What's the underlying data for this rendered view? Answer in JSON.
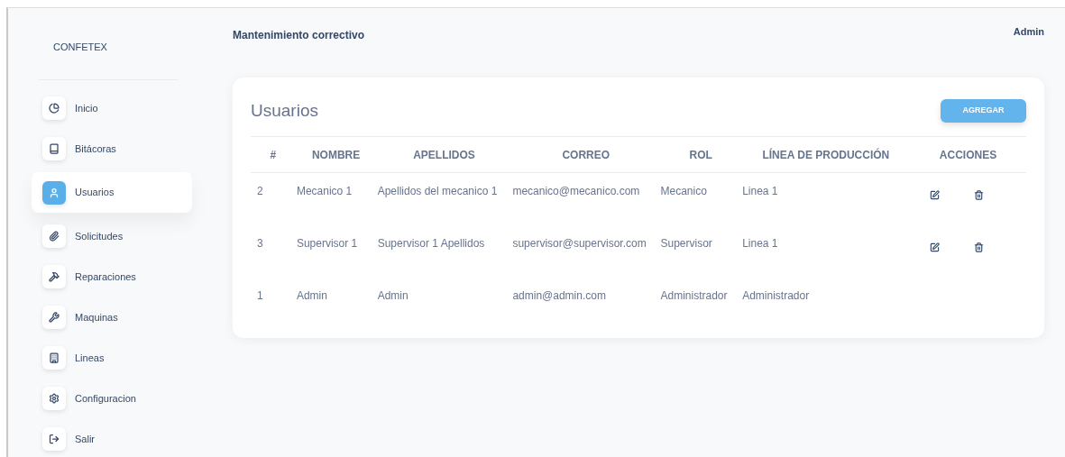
{
  "sidebar": {
    "brand": "CONFETEX",
    "items": [
      {
        "label": "Inicio",
        "selected": false
      },
      {
        "label": "Bitácoras",
        "selected": false
      },
      {
        "label": "Usuarios",
        "selected": true
      },
      {
        "label": "Solicitudes",
        "selected": false
      },
      {
        "label": "Reparaciones",
        "selected": false
      },
      {
        "label": "Maquinas",
        "selected": false
      },
      {
        "label": "Lineas",
        "selected": false
      },
      {
        "label": "Configuracion",
        "selected": false
      },
      {
        "label": "Salir",
        "selected": false
      }
    ]
  },
  "header": {
    "title": "Mantenimiento correctivo",
    "user": "Admin"
  },
  "card": {
    "title": "Usuarios",
    "add_button": "AGREGAR",
    "table": {
      "columns": [
        "#",
        "NOMBRE",
        "APELLIDOS",
        "CORREO",
        "ROL",
        "LÍNEA DE PRODUCCIÓN",
        "ACCIONES"
      ],
      "rows": [
        {
          "cells": [
            "2",
            "Mecanico 1",
            "Apellidos del mecanico 1",
            "mecanico@mecanico.com",
            "Mecanico",
            "Linea 1"
          ],
          "actions": true
        },
        {
          "cells": [
            "3",
            "Supervisor 1",
            "Supervisor 1 Apellidos",
            "supervisor@supervisor.com",
            "Supervisor",
            "Linea 1"
          ],
          "actions": true
        },
        {
          "cells": [
            "1",
            "Admin",
            "Admin",
            "admin@admin.com",
            "Administrador",
            "Administrador"
          ],
          "actions": false
        }
      ]
    }
  }
}
